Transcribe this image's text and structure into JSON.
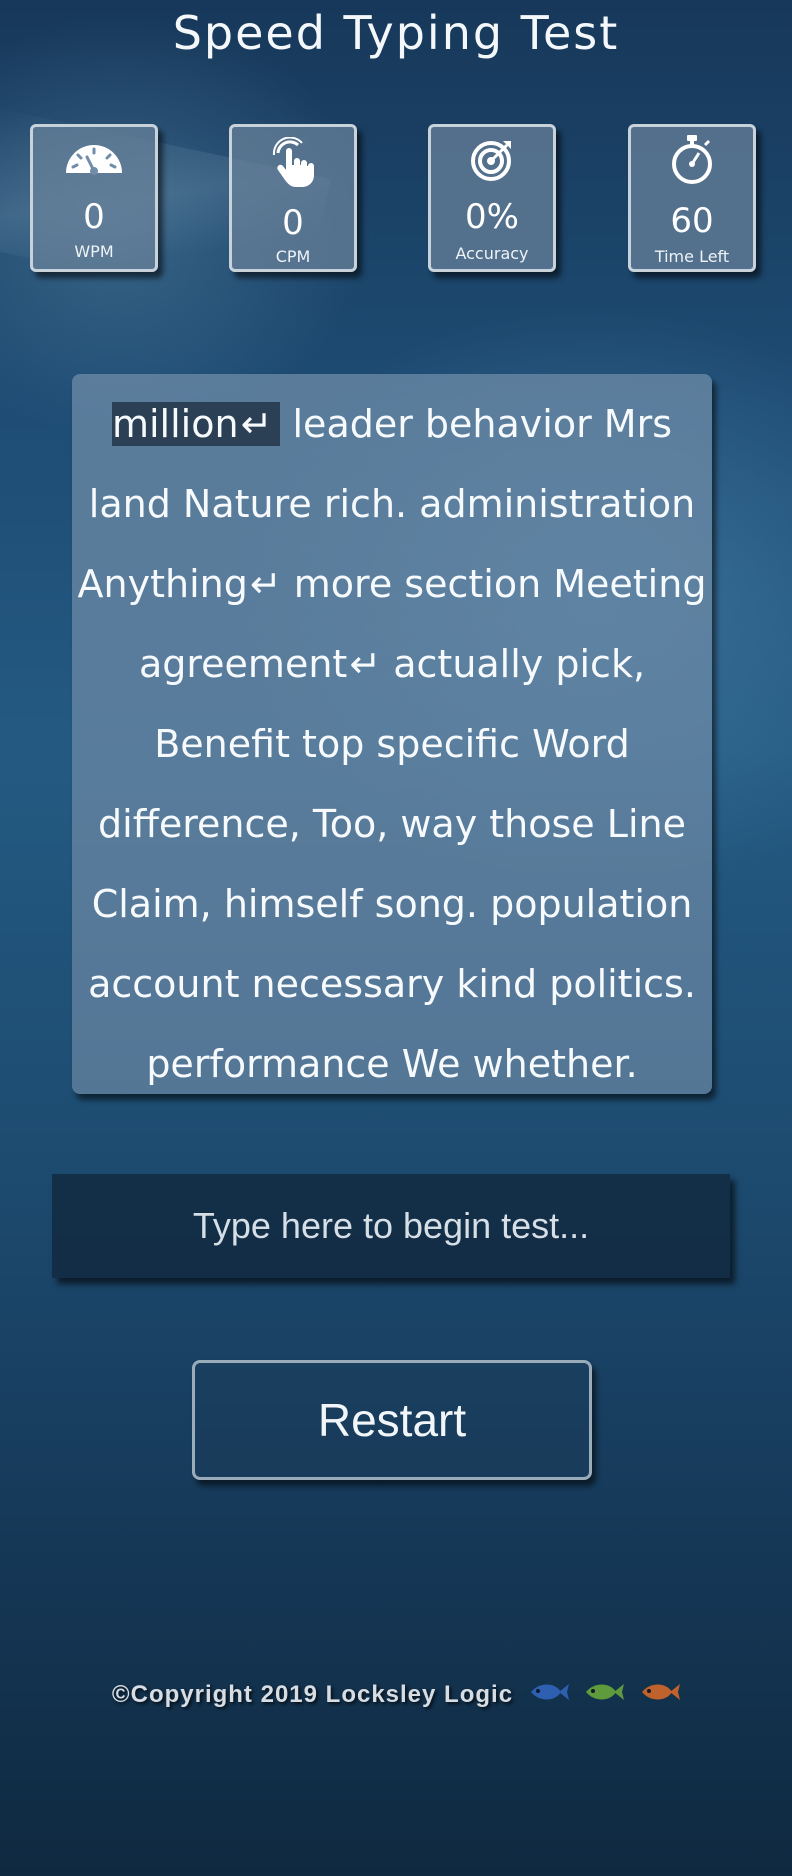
{
  "app": {
    "title": "Speed Typing Test"
  },
  "stats": {
    "wpm": {
      "value": "0",
      "label": "WPM",
      "icon": "speedometer-icon"
    },
    "cpm": {
      "value": "0",
      "label": "CPM",
      "icon": "pointer-hand-icon"
    },
    "accuracy": {
      "value": "0%",
      "label": "Accuracy",
      "icon": "target-icon"
    },
    "time": {
      "value": "60",
      "label": "Time Left",
      "icon": "stopwatch-icon"
    }
  },
  "passage": {
    "current_word": "million",
    "lines": [
      " leader behavior Mrs",
      "land Nature rich. administration",
      "Anything",
      " more section Meeting",
      "agreement",
      " actually pick,",
      "Benefit top specific Word",
      "difference, Too, way those Line",
      "Claim, himself song. population",
      "account necessary kind politics.",
      "performance We whether."
    ],
    "return_symbol": "↵"
  },
  "input": {
    "placeholder": "Type here to begin test..."
  },
  "restart": {
    "label": "Restart"
  },
  "footer": {
    "copyright": "©Copyright 2019 Locksley Logic",
    "fish_colors": [
      "#2f5fb0",
      "#5f9a3c",
      "#c0622e"
    ]
  },
  "colors": {
    "panel": "#6f8ca8",
    "input_bg": "#122a42",
    "highlight": "#2b4055"
  }
}
